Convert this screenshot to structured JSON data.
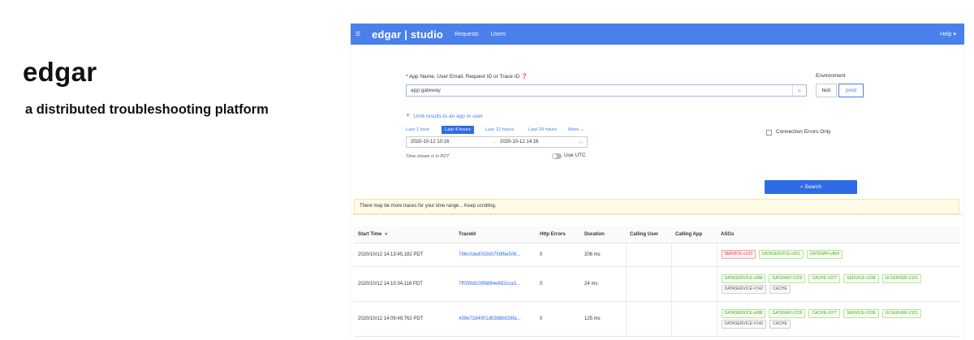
{
  "slide": {
    "title": "edgar",
    "subtitle": "a distributed troubleshooting platform"
  },
  "topbar": {
    "menu_icon": "≡",
    "brand": "edgar | studio",
    "nav": [
      "Requests",
      "Users"
    ],
    "help": "Help ▾"
  },
  "form": {
    "query_label": "* App Name, User Email, Request ID or Trace ID",
    "query_value": "app:gateway",
    "environment_label": "Environment",
    "environments": [
      {
        "label": "test",
        "active": false
      },
      {
        "label": "prod",
        "active": true
      }
    ],
    "limit_link": "Limit results to an app or user",
    "ranges": [
      {
        "label": "Last 1 hour",
        "active": false
      },
      {
        "label": "Last 4 hours",
        "active": true
      },
      {
        "label": "Last 12 hours",
        "active": false
      },
      {
        "label": "Last 24 hours",
        "active": false
      },
      {
        "label": "More ⌄",
        "active": false
      }
    ],
    "date_start": "2020-10-12 10:16",
    "date_sep": "→",
    "date_end": "2020-10-12 14:16",
    "timezone_note": "Time shown is in PDT",
    "use_utc": "Use UTC",
    "connection_errors": "Connection Errors Only",
    "search_button": "Search"
  },
  "notice": "There may be more traces for your time range... Keep scrolling.",
  "table": {
    "columns": [
      "Start Time",
      "TraceId",
      "Http Errors",
      "Duration",
      "Calling User",
      "Calling App",
      "ASGs"
    ],
    "rows": [
      {
        "start": "2020/10/12 14:13:45,182 PDT",
        "trace": "796c0ded002b0759fbe506...",
        "errors": "0",
        "duration": "206 ms",
        "asgs": [
          {
            "label": "SERVICE-v123",
            "color": "red"
          },
          {
            "label": "DATASERVICE-v001",
            "color": "green"
          },
          {
            "label": "GATEWAY-v804",
            "color": "green"
          }
        ]
      },
      {
        "start": "2020/10/12 14:10:34,116 PDT",
        "trace": "7ff039d100fb884e882cca3...",
        "errors": "0",
        "duration": "24 ms",
        "asgs": [
          {
            "label": "DATASERVICE-v088",
            "color": "green"
          },
          {
            "label": "GATEWAY-V228",
            "color": "green"
          },
          {
            "label": "CACHE-V077",
            "color": "green"
          },
          {
            "label": "SERVICE-V338",
            "color": "green"
          },
          {
            "label": "UI-SERVER-V101",
            "color": "green"
          },
          {
            "label": "DATASERVICE-V142",
            "color": "gray"
          },
          {
            "label": "CACHE",
            "color": "gray"
          }
        ]
      },
      {
        "start": "2020/10/12 14:09:49,762 PDT",
        "trace": "439e72d4001d5388b026fa...",
        "errors": "0",
        "duration": "125 ms",
        "asgs": [
          {
            "label": "DATASERVICE-v088",
            "color": "green"
          },
          {
            "label": "GATEWAY-V228",
            "color": "green"
          },
          {
            "label": "CACHE-V077",
            "color": "green"
          },
          {
            "label": "SERVICE-V338",
            "color": "green"
          },
          {
            "label": "UI-SERVER-V101",
            "color": "green"
          },
          {
            "label": "DATASERVICE-V142",
            "color": "gray"
          },
          {
            "label": "CACHE",
            "color": "gray"
          }
        ]
      }
    ]
  },
  "colors": {
    "accent": "#4a80ea",
    "button": "#2f6be6"
  }
}
